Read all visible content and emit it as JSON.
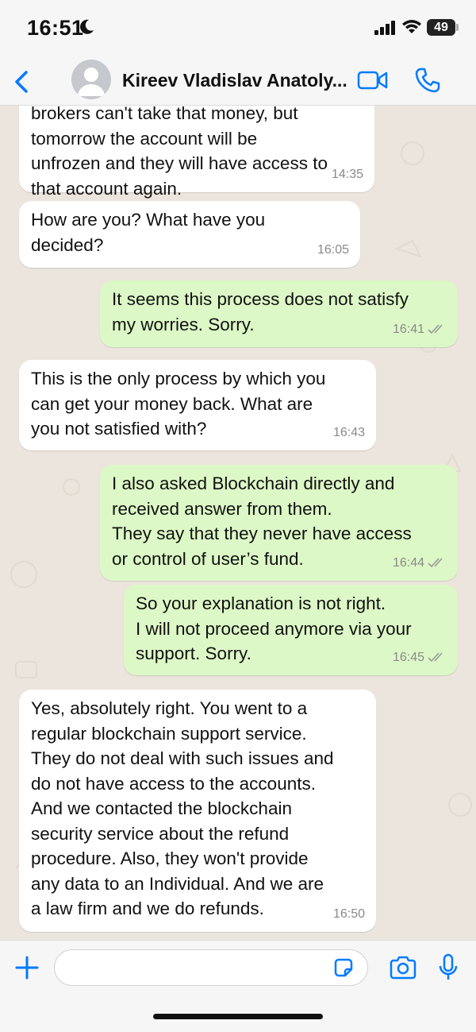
{
  "status_bar": {
    "time": "16:51",
    "battery": "49"
  },
  "header": {
    "contact_name": "Kireev Vladislav Anatoly..."
  },
  "messages": [
    {
      "direction": "in",
      "text": "brokers can't take that money, but\ntomorrow the account will be\nunfrozen and they will have access to\nthat account again.",
      "time": "14:35"
    },
    {
      "direction": "in",
      "text": "How are you? What have you\ndecided?",
      "time": "16:05"
    },
    {
      "direction": "out",
      "text": "It seems this process does not satisfy\nmy worries. Sorry.",
      "time": "16:41",
      "status": "read"
    },
    {
      "direction": "in",
      "text": "This is the only process by which you\ncan get your money back. What are\nyou not satisfied with?",
      "time": "16:43"
    },
    {
      "direction": "out",
      "text": "I also asked Blockchain directly and\nreceived answer from them.\nThey say that they never have access\nor control of user’s fund.",
      "time": "16:44",
      "status": "read"
    },
    {
      "direction": "out",
      "text": "So your explanation is not right.\nI will not proceed anymore via your\nsupport. Sorry.",
      "time": "16:45",
      "status": "read"
    },
    {
      "direction": "in",
      "text": "Yes, absolutely right. You went to a\nregular blockchain support service.\nThey do not deal with such issues and\ndo not have access to the accounts.\nAnd we contacted the blockchain\nsecurity service about the refund\nprocedure. Also, they won't provide\nany data to an Individual. And we are\na law firm and we do refunds.",
      "time": "16:50"
    }
  ],
  "input": {
    "value": ""
  },
  "colors": {
    "accent": "#007aff",
    "outgoing": "#dcf8c6",
    "incoming": "#ffffff"
  }
}
